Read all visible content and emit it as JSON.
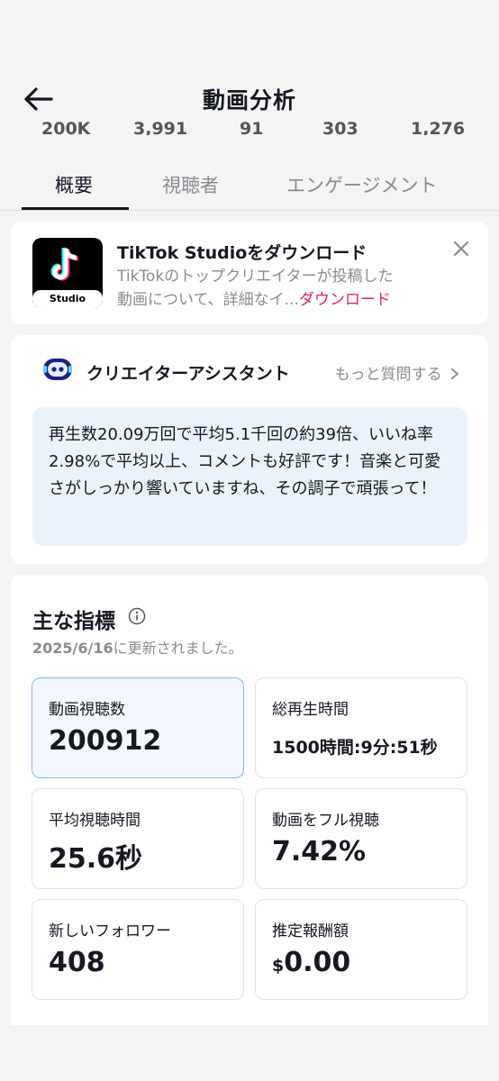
{
  "header": {
    "title": "動画分析",
    "cut_stats": [
      "200K",
      "3,991",
      "91",
      "303",
      "1,276"
    ]
  },
  "tabs": [
    {
      "label": "概要"
    },
    {
      "label": "視聴者"
    },
    {
      "label": "エンゲージメント"
    }
  ],
  "download_card": {
    "icon_label": "Studio",
    "title": "TikTok Studioをダウンロード",
    "desc_line1": "TikTokのトップクリエイターが投稿した",
    "desc_line2": "動画について、詳細なイ...",
    "link": "ダウンロード"
  },
  "assistant": {
    "title": "クリエイターアシスタント",
    "more": "もっと質問する",
    "message": "再生数20.09万回で平均5.1千回の約39倍、いいね率2.98%で平均以上、コメントも好評です！音楽と可愛さがしっかり響いていますね、その調子で頑張って！"
  },
  "metrics": {
    "title": "主な指標",
    "updated_date": "2025/6/16",
    "updated_suffix": "に更新されました。",
    "items": [
      {
        "label": "動画視聴数",
        "value": "200912"
      },
      {
        "label": "総再生時間",
        "value": "1500時間:9分:51秒"
      },
      {
        "label": "平均視聴時間",
        "value": "25.6秒"
      },
      {
        "label": "動画をフル視聴",
        "value": "7.42%"
      },
      {
        "label": "新しいフォロワー",
        "value": "408"
      },
      {
        "label": "推定報酬額",
        "currency": "$",
        "value": "0.00"
      }
    ]
  }
}
